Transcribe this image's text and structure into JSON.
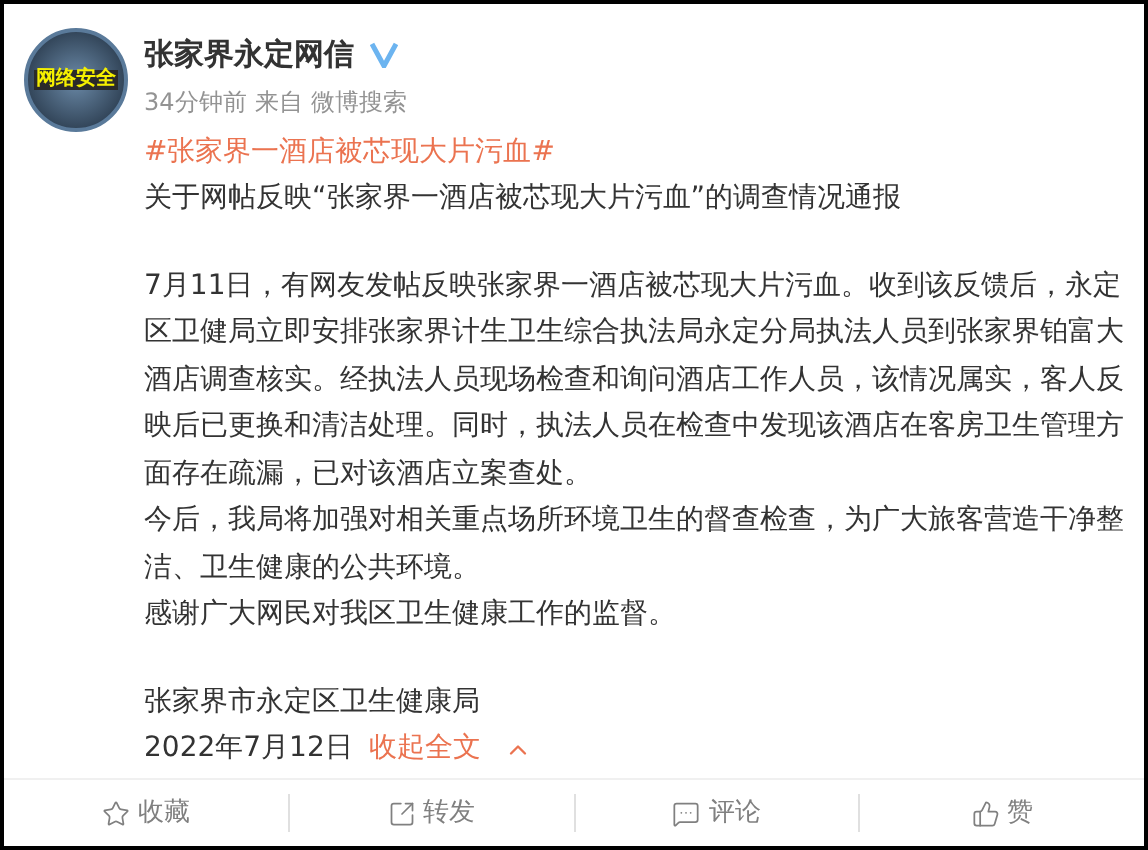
{
  "post": {
    "author": "张家界永定网信",
    "verified": true,
    "avatar_text": "网络安全",
    "time": "34分钟前",
    "source_prefix": "来自",
    "source": "微博搜索",
    "hashtag": "#张家界一酒店被芯现大片污血#",
    "paragraphs": [
      "关于网帖反映“张家界一酒店被芯现大片污血”的调查情况通报",
      "7月11日，有网友发帖反映张家界一酒店被芯现大片污血。收到该反馈后，永定区卫健局立即安排张家界计生卫生综合执法局永定分局执法人员到张家界铂富大酒店调查核实。经执法人员现场检查和询问酒店工作人员，该情况属实，客人反映后已更换和清洁处理。同时，执法人员在检查中发现该酒店在客房卫生管理方面存在疏漏，已对该酒店立案查处。",
      "今后，我局将加强对相关重点场所环境卫生的督查检查，为广大旅客营造干净整洁、卫生健康的公共环境。",
      "感谢广大网民对我区卫生健康工作的监督。"
    ],
    "signature": "张家界市永定区卫生健康局",
    "date": "2022年7月12日",
    "collapse_link": "收起全文"
  },
  "actions": [
    {
      "kind": "star",
      "label": "收藏"
    },
    {
      "kind": "share",
      "label": "转发"
    },
    {
      "kind": "comment",
      "label": "评论"
    },
    {
      "kind": "like",
      "label": "赞"
    }
  ]
}
